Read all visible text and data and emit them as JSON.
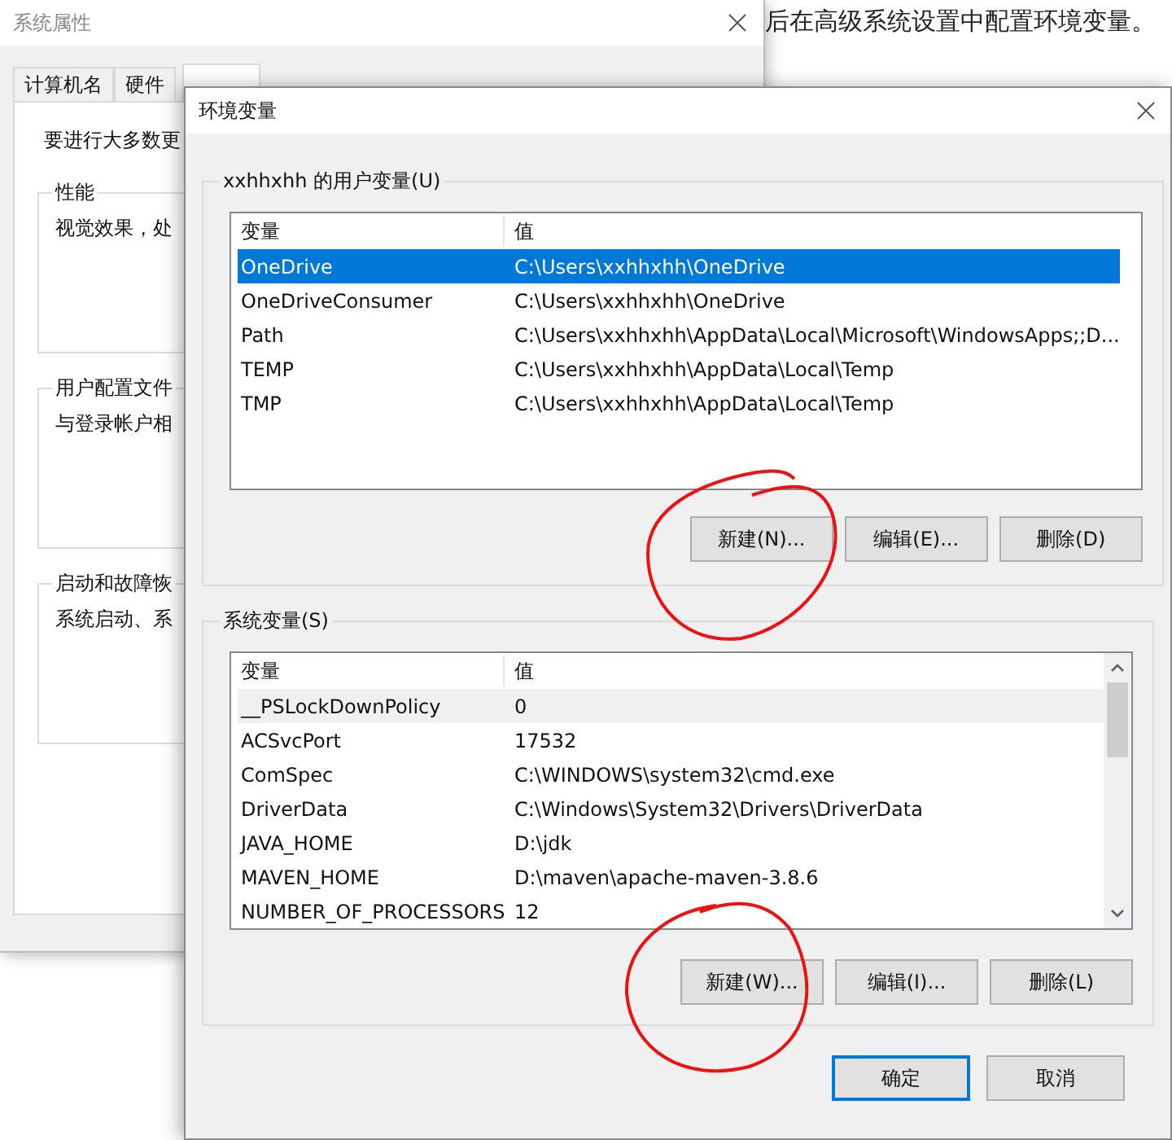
{
  "background_text": "后在高级系统设置中配置环境变量。",
  "system_properties": {
    "title": "系统属性",
    "tabs": [
      {
        "label": "计算机名",
        "selected": false
      },
      {
        "label": "硬件",
        "selected": false
      },
      {
        "selected": true
      }
    ],
    "intro": "要进行大多数更",
    "groups": [
      {
        "title": "性能",
        "text": "视觉效果，处"
      },
      {
        "title": "用户配置文件",
        "text": "与登录帐户相"
      },
      {
        "title": "启动和故障恢",
        "text": "系统启动、系"
      }
    ]
  },
  "dialog": {
    "title": "环境变量",
    "user_vars": {
      "label": "xxhhxhh 的用户变量(U)",
      "columns": [
        "变量",
        "值"
      ],
      "rows": [
        {
          "name": "OneDrive",
          "value": "C:\\Users\\xxhhxhh\\OneDrive",
          "selected": true
        },
        {
          "name": "OneDriveConsumer",
          "value": "C:\\Users\\xxhhxhh\\OneDrive",
          "selected": false
        },
        {
          "name": "Path",
          "value": "C:\\Users\\xxhhxhh\\AppData\\Local\\Microsoft\\WindowsApps;;D...",
          "selected": false
        },
        {
          "name": "TEMP",
          "value": "C:\\Users\\xxhhxhh\\AppData\\Local\\Temp",
          "selected": false
        },
        {
          "name": "TMP",
          "value": "C:\\Users\\xxhhxhh\\AppData\\Local\\Temp",
          "selected": false
        }
      ],
      "buttons": [
        "新建(N)...",
        "编辑(E)...",
        "删除(D)"
      ]
    },
    "system_vars": {
      "label": "系统变量(S)",
      "columns": [
        "变量",
        "值"
      ],
      "rows": [
        {
          "name": "__PSLockDownPolicy",
          "value": "0",
          "selected": false,
          "hovered": true
        },
        {
          "name": "ACSvcPort",
          "value": "17532",
          "selected": false,
          "hovered": false
        },
        {
          "name": "ComSpec",
          "value": "C:\\WINDOWS\\system32\\cmd.exe",
          "selected": false,
          "hovered": false
        },
        {
          "name": "DriverData",
          "value": "C:\\Windows\\System32\\Drivers\\DriverData",
          "selected": false,
          "hovered": false
        },
        {
          "name": "JAVA_HOME",
          "value": "D:\\jdk",
          "selected": false,
          "hovered": false
        },
        {
          "name": "MAVEN_HOME",
          "value": "D:\\maven\\apache-maven-3.8.6",
          "selected": false,
          "hovered": false
        },
        {
          "name": "NUMBER_OF_PROCESSORS",
          "value": "12",
          "selected": false,
          "hovered": false
        }
      ],
      "buttons": [
        "新建(W)...",
        "编辑(I)...",
        "删除(L)"
      ]
    },
    "footer_buttons": [
      {
        "label": "确定",
        "default": true
      },
      {
        "label": "取消",
        "default": false
      }
    ]
  }
}
